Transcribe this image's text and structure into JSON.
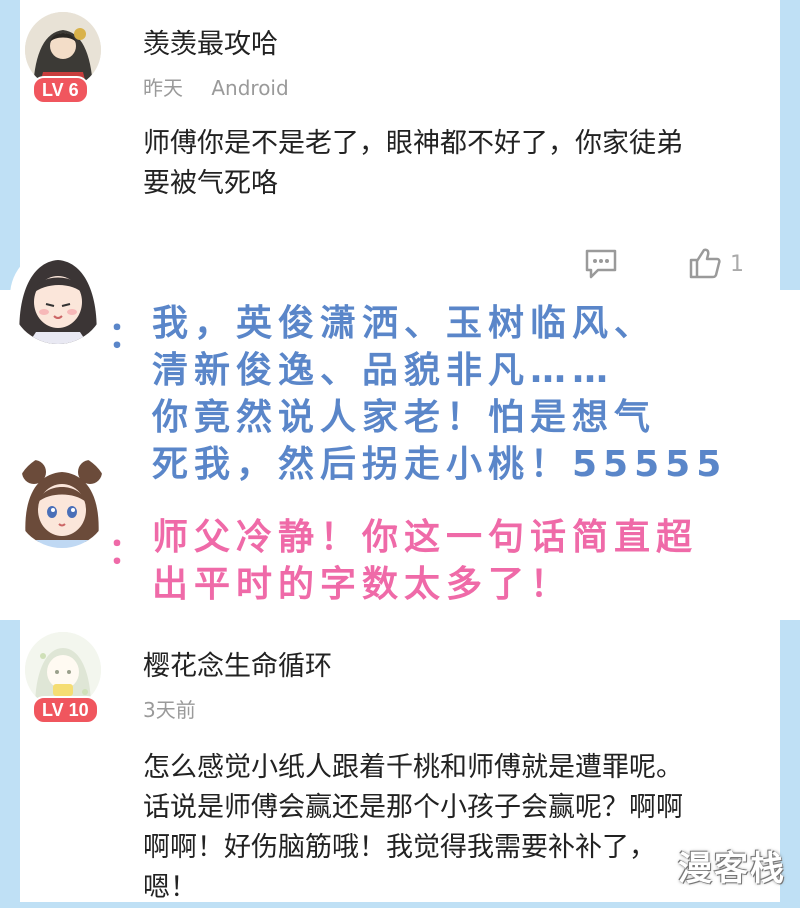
{
  "comments": [
    {
      "username": "羡羡最攻哈",
      "time": "昨天",
      "device": "Android",
      "level": "LV 6",
      "text": "师傅你是不是老了，眼神都不好了，你家徒弟\n要被气死咯",
      "likes": "1"
    },
    {
      "username": "樱花念生命循环",
      "time": "3天前",
      "level": "LV 10",
      "text": "怎么感觉小纸人跟着千桃和师傅就是遭罪呢。\n话说是师傅会赢还是那个小孩子会赢呢？啊啊\n啊啊！好伤脑筋哦！我觉得我需要补补了，\n嗯！"
    }
  ],
  "dialogue": [
    {
      "speaker_icon": "long-haired-girl-avatar-icon",
      "color": "#5a86c9",
      "lines": [
        "我，英俊潇洒、玉树临风、",
        "清新俊逸、品貌非凡……",
        "你竟然说人家老！怕是想气",
        "死我，然后拐走小桃！55555"
      ]
    },
    {
      "speaker_icon": "twin-bun-girl-avatar-icon",
      "color": "#ef6aa8",
      "lines": [
        "师父冷静！你这一句话简直超",
        "出平时的字数太多了！"
      ]
    }
  ],
  "colon": "：",
  "watermark": "漫客栈"
}
